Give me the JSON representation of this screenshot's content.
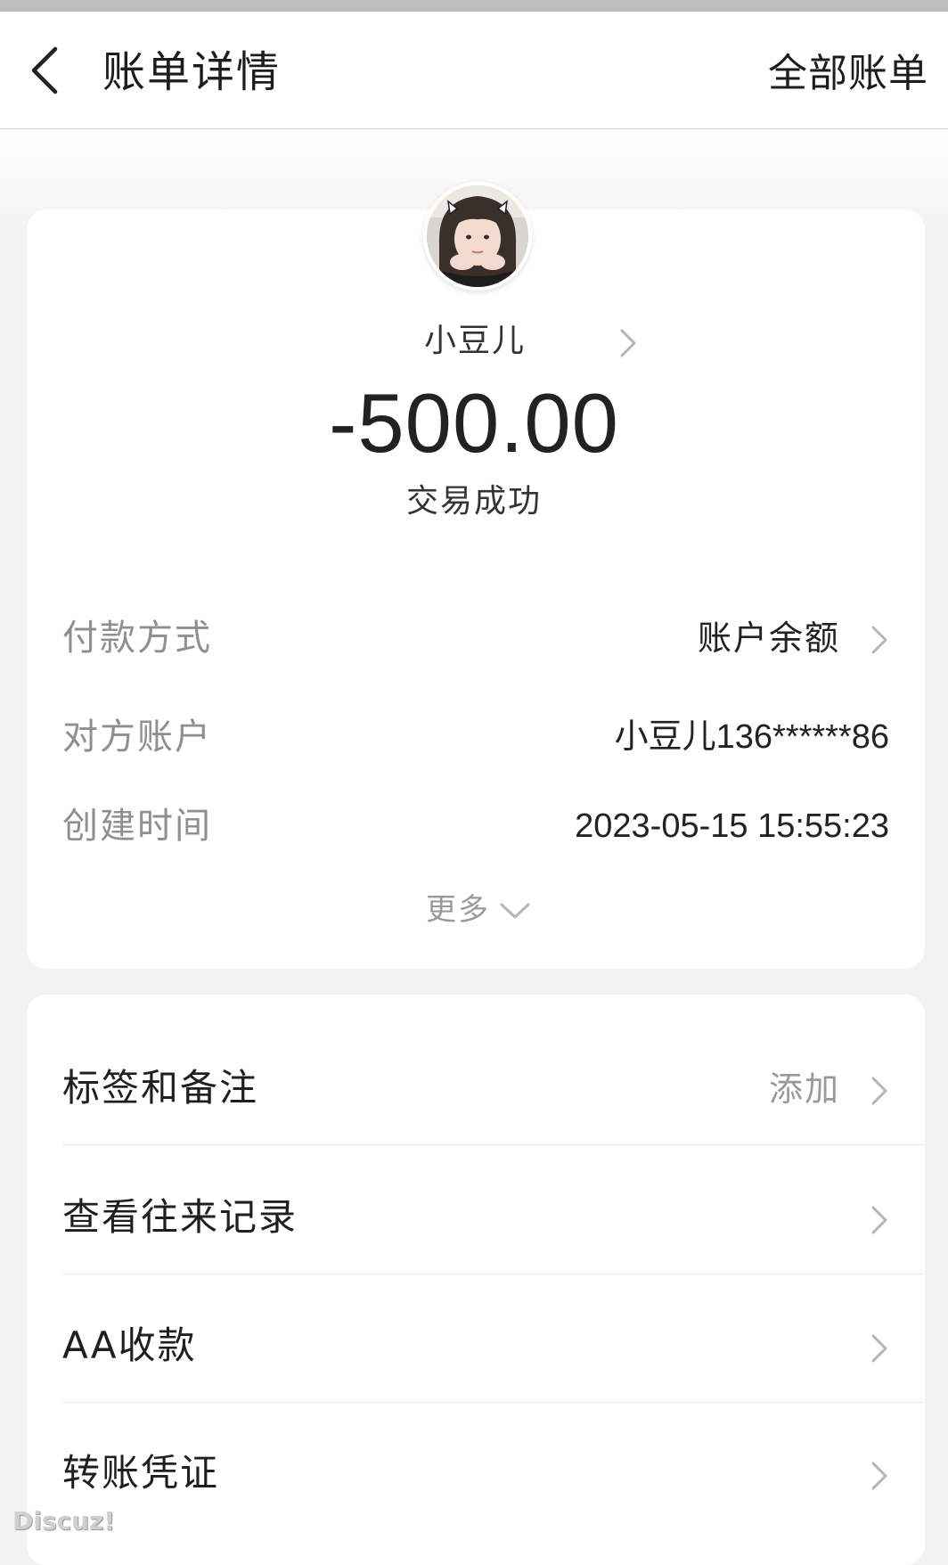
{
  "nav": {
    "title": "账单详情",
    "all_bills_label": "全部账单"
  },
  "payee": {
    "name": "小豆儿"
  },
  "amount": "-500.00",
  "status": "交易成功",
  "details": [
    {
      "label": "付款方式",
      "value": "账户余额"
    },
    {
      "label": "对方账户",
      "value": "小豆儿136******86"
    },
    {
      "label": "创建时间",
      "value": "2023-05-15 15:55:23"
    }
  ],
  "more_label": "更多",
  "actions": [
    {
      "label": "标签和备注",
      "hint": "添加"
    },
    {
      "label": "查看往来记录"
    },
    {
      "label": "AA收款"
    },
    {
      "label": "转账凭证"
    }
  ],
  "watermark": "Discuz!",
  "icons": {
    "back": "chevron-left-icon",
    "row": "chevron-right-icon",
    "more": "chevron-down-icon"
  },
  "colors": {
    "background": "#f2f2f2",
    "card": "#ffffff",
    "label_gray": "#8f8f8f",
    "text": "#222222"
  }
}
